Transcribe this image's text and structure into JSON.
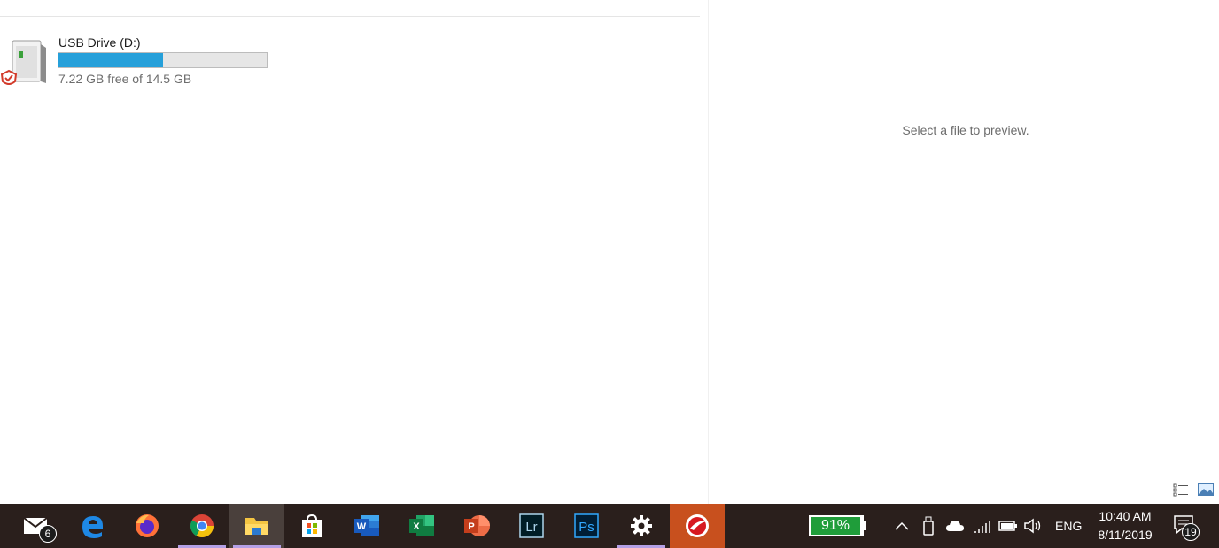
{
  "drive": {
    "name": "USB Drive (D:)",
    "free_text": "7.22 GB free of 14.5 GB",
    "used_fraction": 0.502
  },
  "preview": {
    "message": "Select a file to preview."
  },
  "taskbar": {
    "apps": [
      {
        "name": "Mail",
        "badge": "6"
      },
      {
        "name": "Microsoft Edge"
      },
      {
        "name": "Firefox"
      },
      {
        "name": "Chrome"
      },
      {
        "name": "File Explorer"
      },
      {
        "name": "Microsoft Store"
      },
      {
        "name": "Word"
      },
      {
        "name": "Excel"
      },
      {
        "name": "PowerPoint"
      },
      {
        "name": "Lightroom"
      },
      {
        "name": "Photoshop"
      },
      {
        "name": "Settings"
      },
      {
        "name": "Trend Micro"
      }
    ],
    "battery_percent": "91%",
    "language": "ENG",
    "time": "10:40 AM",
    "date": "8/11/2019",
    "notification_count": "19"
  },
  "colors": {
    "accent": "#26a0da",
    "taskbar": "#2a1f1c",
    "battery": "#1f9d3a"
  }
}
